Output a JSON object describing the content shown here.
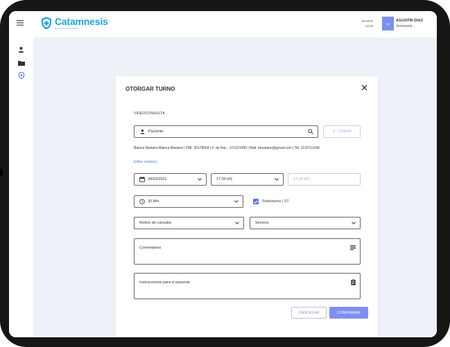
{
  "header": {
    "brand_name": "Catamnesis",
    "brand_tagline": "SALUD INTEGRAL",
    "date": "09 MAR",
    "time": "10:30",
    "user_initials": "AD",
    "user_name": "AGUSTÍN DIAZ",
    "user_sub": "Venezuela"
  },
  "modal": {
    "title": "OTORGAR TURNO",
    "section": "VIDEOCONSULTA",
    "patient_placeholder": "Paciente",
    "create_label": "CREAR",
    "patient_info": "Bianca Mariano Bianca Mariano | DNI: 35178564 | F. de Nac.: 07/12/1990 | Mail: bmariano@gmail.com | Tel: 1132711046",
    "edit_contact": "Editar contacto",
    "date_value": "28/09/2021",
    "start_time": "17:00 HS",
    "end_time": "17:30 HS",
    "duration": "30 Min",
    "overbooking_label": "Sobreturno | ST",
    "reason_placeholder": "Motivo de consulta",
    "service_placeholder": "Servicio",
    "comments_placeholder": "Comentarios",
    "instructions_placeholder": "Instrucciones para el paciente",
    "cancel_label": "CANCELAR",
    "confirm_label": "CONFIRMAR"
  },
  "colors": {
    "brand": "#1ea3d6",
    "accent": "#7c8ff0",
    "checkbox": "#5b74e8",
    "link": "#4a7bd8"
  },
  "icons": {
    "menu": "hamburger-icon",
    "user": "person-icon",
    "folder": "folder-icon",
    "shield": "shield-icon",
    "close": "close-icon",
    "search": "search-icon",
    "calendar": "calendar-icon",
    "clock": "clock-icon",
    "notes": "notes-icon",
    "clipboard": "clipboard-icon"
  }
}
